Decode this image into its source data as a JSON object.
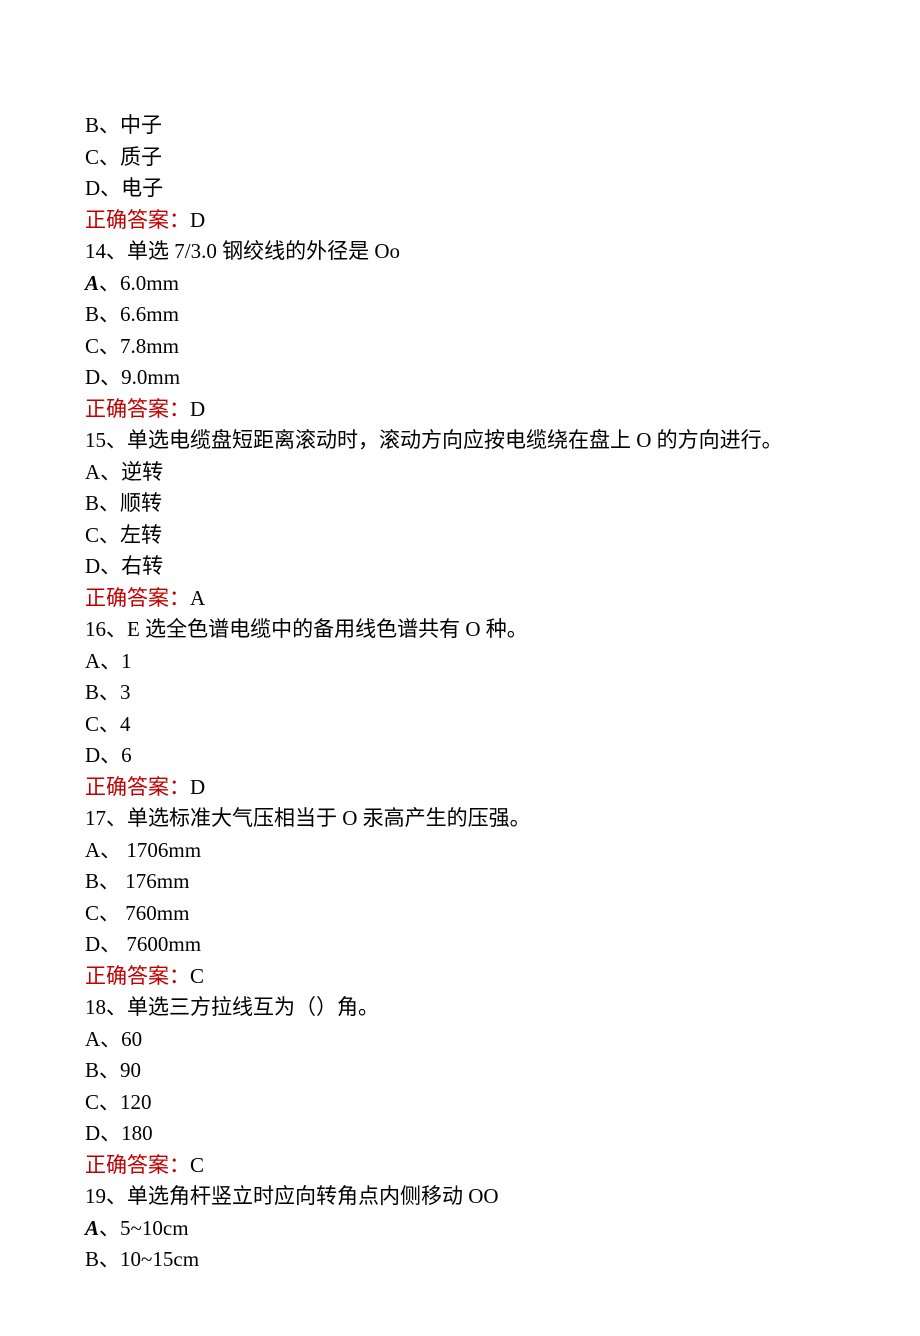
{
  "lines": [
    {
      "type": "text",
      "content": "B、中子"
    },
    {
      "type": "text",
      "content": "C、质子"
    },
    {
      "type": "text",
      "content": "D、电子"
    },
    {
      "type": "answer",
      "label": "正确答案：",
      "value": "D"
    },
    {
      "type": "text",
      "content": "14、单选 7/3.0 钢绞线的外径是 Oo"
    },
    {
      "type": "option-italic",
      "prefix": "A",
      "sep": "、",
      "value": "6.0mm"
    },
    {
      "type": "text",
      "content": "B、6.6mm"
    },
    {
      "type": "text",
      "content": "C、7.8mm"
    },
    {
      "type": "text",
      "content": "D、9.0mm"
    },
    {
      "type": "answer",
      "label": "正确答案：",
      "value": "D"
    },
    {
      "type": "text",
      "content": "15、单选电缆盘短距离滚动时，滚动方向应按电缆绕在盘上 O 的方向进行。"
    },
    {
      "type": "text",
      "content": "A、逆转"
    },
    {
      "type": "text",
      "content": "B、顺转"
    },
    {
      "type": "text",
      "content": "C、左转"
    },
    {
      "type": "text",
      "content": "D、右转"
    },
    {
      "type": "answer",
      "label": "正确答案：",
      "value": "A"
    },
    {
      "type": "text",
      "content": "16、E 选全色谱电缆中的备用线色谱共有 O 种。"
    },
    {
      "type": "text",
      "content": "A、1"
    },
    {
      "type": "text",
      "content": "B、3"
    },
    {
      "type": "text",
      "content": "C、4"
    },
    {
      "type": "text",
      "content": "D、6"
    },
    {
      "type": "answer",
      "label": "正确答案：",
      "value": "D"
    },
    {
      "type": "text",
      "content": "17、单选标准大气压相当于 O 汞高产生的压强。"
    },
    {
      "type": "text",
      "content": "A、 1706mm"
    },
    {
      "type": "text",
      "content": "B、 176mm"
    },
    {
      "type": "text",
      "content": "C、 760mm"
    },
    {
      "type": "text",
      "content": "D、 7600mm"
    },
    {
      "type": "answer",
      "label": "正确答案：",
      "value": "C"
    },
    {
      "type": "text",
      "content": "18、单选三方拉线互为（）角。"
    },
    {
      "type": "text",
      "content": "A、60"
    },
    {
      "type": "text",
      "content": "B、90"
    },
    {
      "type": "text",
      "content": "C、120"
    },
    {
      "type": "text",
      "content": "D、180"
    },
    {
      "type": "answer",
      "label": "正确答案：",
      "value": "C"
    },
    {
      "type": "text",
      "content": "19、单选角杆竖立时应向转角点内侧移动 OO"
    },
    {
      "type": "option-italic",
      "prefix": "A",
      "sep": "、",
      "value": "5~10cm"
    },
    {
      "type": "text",
      "content": "B、10~15cm"
    }
  ]
}
